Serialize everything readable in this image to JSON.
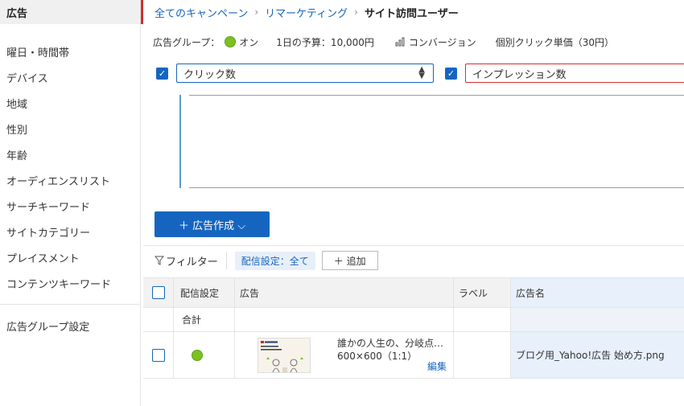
{
  "sidebar": {
    "top_label": "広告",
    "items": [
      {
        "label": "曜日・時間帯"
      },
      {
        "label": "デバイス"
      },
      {
        "label": "地域"
      },
      {
        "label": "性別"
      },
      {
        "label": "年齢"
      },
      {
        "label": "オーディエンスリスト"
      },
      {
        "label": "サーチキーワード"
      },
      {
        "label": "サイトカテゴリー"
      },
      {
        "label": "プレイスメント"
      },
      {
        "label": "コンテンツキーワード"
      }
    ],
    "bottom_item": "広告グループ設定"
  },
  "breadcrumb": {
    "items": [
      "全てのキャンペーン",
      "リマーケティング"
    ],
    "separator": "›",
    "current": "サイト訪問ユーザー"
  },
  "infobar": {
    "group_label": "広告グループ：",
    "status": "オン",
    "budget": "1日の予算：10,000円",
    "conversion": "コンバージョン",
    "cpc": "個別クリック単価（30円）"
  },
  "metrics": {
    "select1": "クリック数",
    "select2": "インプレッション数"
  },
  "create_button": "＋ 広告作成 ⌵",
  "toolbar": {
    "filter": "フィルター",
    "chip": "配信設定：全て",
    "add": "＋ 追加"
  },
  "table": {
    "headers": [
      "配信設定",
      "広告",
      "ラベル",
      "広告名"
    ],
    "summary_label": "合計",
    "rows": [
      {
        "ad_title": "誰かの人生の、分岐点…",
        "ad_size": "600×600（1:1）",
        "edit": "編集",
        "ad_name": "ブログ用_Yahoo!広告 始め方.png"
      }
    ]
  },
  "colors": {
    "accent": "#1565c0",
    "active_marker": "#d32f2f",
    "status_on": "#7cc122"
  }
}
